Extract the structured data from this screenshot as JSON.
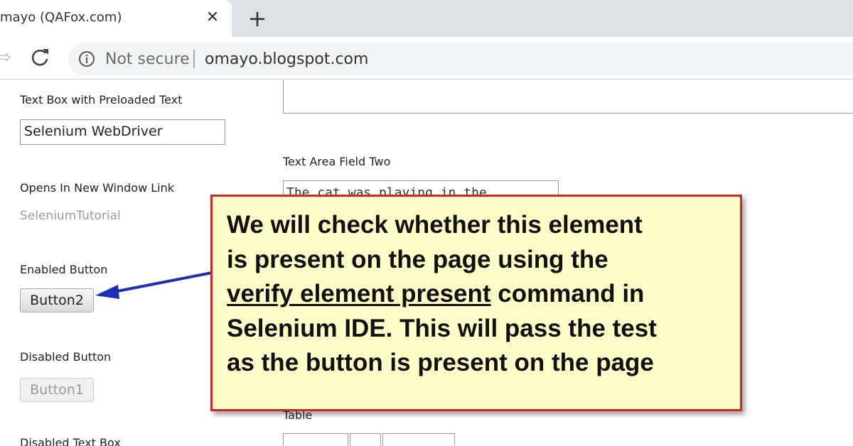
{
  "browser": {
    "tab_title": "mayo (QAFox.com)",
    "tab_close_glyph": "✕",
    "new_tab_glyph": "+",
    "forward_glyph": "⇨",
    "security_label": "Not secure",
    "url": "omayo.blogspot.com"
  },
  "page": {
    "preloaded_label": "Text Box with Preloaded Text",
    "preloaded_value": "Selenium WebDriver",
    "textarea_two_label": "Text Area Field Two",
    "textarea_two_value": "The cat was playing in the",
    "new_window_label": "Opens In New Window Link",
    "new_window_link": "SeleniumTutorial",
    "enabled_button_label": "Enabled Button",
    "enabled_button_text": "Button2",
    "disabled_button_label": "Disabled Button",
    "disabled_button_text": "Button1",
    "table_label": "Table",
    "disabled_textbox_label": "Disabled Text Box"
  },
  "callout": {
    "line1": "We will check whether this element",
    "line2": "is present on the page using the",
    "line3_underlined": "verify element present",
    "line3_rest": " command in",
    "line4": "Selenium IDE. This will pass the test",
    "line5": "as the button is present on the page"
  },
  "colors": {
    "callout_fill": "#fefdc8",
    "callout_border": "#cc2a2a",
    "arrow": "#1f2fb5"
  },
  "icons": [
    "forward-icon",
    "reload-icon",
    "info-icon",
    "close-icon",
    "plus-icon"
  ]
}
